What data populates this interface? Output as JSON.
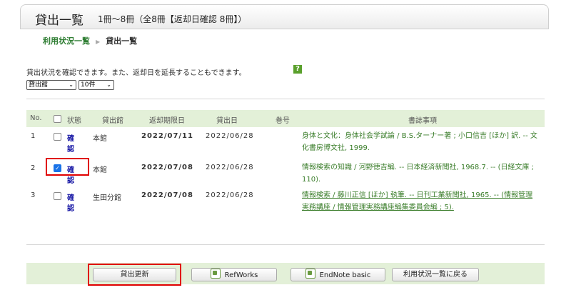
{
  "header": {
    "title": "貸出一覧",
    "count_text": "1冊～8冊（全8冊【返却日確認 8冊】）"
  },
  "breadcrumb": {
    "parent": "利用状況一覧",
    "current": "貸出一覧"
  },
  "info_text": "貸出状況を確認できます。また、返却日を延長することもできます。",
  "help_icon": "?",
  "selects": {
    "sort": "貸出館",
    "per_page": "10件"
  },
  "table": {
    "headers": {
      "no": "No.",
      "status": "状態",
      "library": "貸出館",
      "due": "返却期限日",
      "loan": "貸出日",
      "volume": "巻号",
      "bib": "書誌事項"
    },
    "rows": [
      {
        "no": "1",
        "checked": false,
        "status": "確認",
        "library": "本館",
        "due": "2022/07/11",
        "loan": "2022/06/28",
        "bib": "身体と文化：身体社会学試論 / B.S.ターナー著 ; 小口信吉 [ほか] 訳. -- 文化書房博文社, 1999."
      },
      {
        "no": "2",
        "checked": true,
        "status": "確認",
        "library": "本館",
        "due": "2022/07/08",
        "loan": "2022/06/28",
        "bib": "情報検索の知識 / 河野徳吉編. -- 日本経済新聞社, 1968.7. -- (日経文庫 ; 110)."
      },
      {
        "no": "3",
        "checked": false,
        "status": "確認",
        "library": "生田分館",
        "due": "2022/07/08",
        "loan": "2022/06/28",
        "bib": "情報検索 / 藤川正信 [ほか] 執筆. -- 日刊工業新聞社, 1965. -- (情報管理実務講座 / 情報管理実務講座編集委員会編 ; 5)."
      }
    ]
  },
  "buttons": {
    "renew": "貸出更新",
    "refworks": "RefWorks",
    "endnote": "EndNote basic",
    "back": "利用状況一覧に戻る"
  },
  "colors": {
    "accent_green": "#3a7d2a",
    "header_row": "#e3f0d8",
    "highlight": "#e00000"
  }
}
